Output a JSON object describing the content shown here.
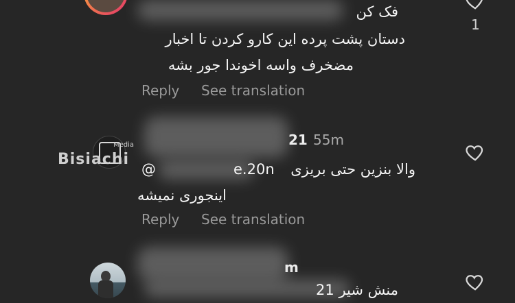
{
  "comments": [
    {
      "lines": [
        "فک کن",
        "دستان پشت پرده این کارو کردن تا اخبار",
        "مضخرف واسه اخوندا جور بشه"
      ],
      "reply_label": "Reply",
      "translate_label": "See translation",
      "like_count": "1"
    },
    {
      "username_tail": "21",
      "time": "55m",
      "mention": "@",
      "mention_tail": "e.20n",
      "lines": [
        "والا بنزین حتی بریزی",
        "اینجوری نمیشه"
      ],
      "reply_label": "Reply",
      "translate_label": "See translation"
    },
    {
      "username_tail": "m",
      "lines": [
        "منش شیر 21"
      ]
    }
  ],
  "watermark": {
    "name": "Bisiachi",
    "tag": "Media"
  },
  "icons": {
    "like": "heart-outline-icon"
  },
  "colors": {
    "background": "#262626",
    "secondary_text": "#9a9a9a"
  }
}
